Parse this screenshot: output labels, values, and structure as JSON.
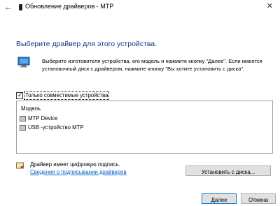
{
  "window": {
    "title": "Обновление драйверов - MTP"
  },
  "heading": "Выберите драйвер для этого устройства.",
  "description": "Выберите изготовителя устройства, его модель и нажмите кнопку \"Далее\". Если имеется установочный диск с драйвером, нажмите кнопку \"Вы хотите установить с диска\".",
  "compatible_checkbox": {
    "label": "Только совместимые устройства",
    "checked": true
  },
  "model_list": {
    "header": "Модель",
    "items": [
      {
        "label": "MTP Device"
      },
      {
        "label": "USB -устройство MTP"
      }
    ]
  },
  "signature": {
    "text": "Драйвер имеет цифровую подпись.",
    "link": "Сведения о подписывании драйверов"
  },
  "buttons": {
    "install_from_disk": "Установить с диска...",
    "next": "Далее",
    "cancel": "Отмена"
  },
  "icons": {
    "back": "back-arrow-icon",
    "close": "close-icon",
    "device": "mobile-device-icon",
    "computer": "computer-icon",
    "signature": "certificate-icon"
  },
  "colors": {
    "heading": "#1e3287",
    "link": "#0066cc",
    "primary_button_border": "#0078d7"
  }
}
